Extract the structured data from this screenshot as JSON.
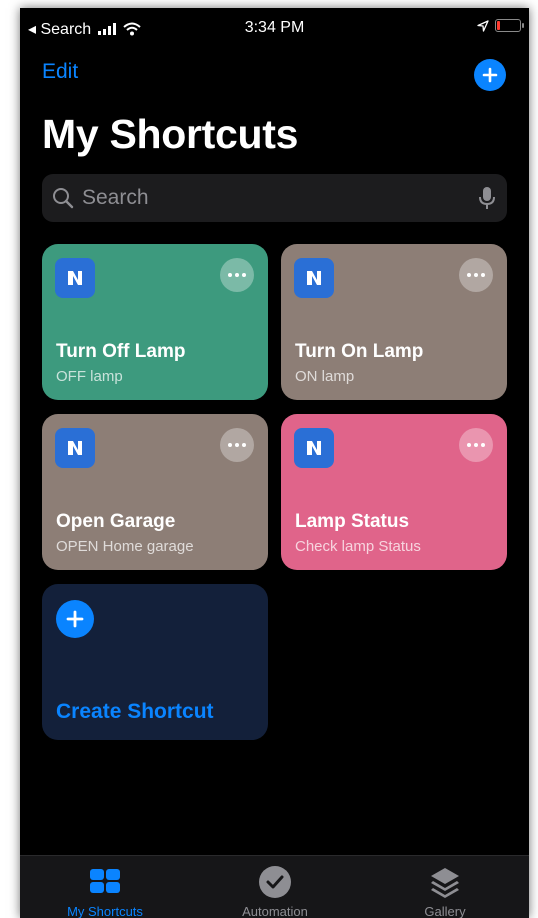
{
  "status_bar": {
    "back_label": "◂ Search",
    "time": "3:34 PM"
  },
  "nav": {
    "edit_label": "Edit",
    "add_icon": "plus-circle-icon"
  },
  "page": {
    "title": "My Shortcuts"
  },
  "search": {
    "placeholder": "Search",
    "value": ""
  },
  "shortcuts": [
    {
      "name": "Turn Off Lamp",
      "subtitle": "OFF lamp",
      "color": "#3d9a7e"
    },
    {
      "name": "Turn On Lamp",
      "subtitle": "ON lamp",
      "color": "#8d7e76"
    },
    {
      "name": "Open Garage",
      "subtitle": "OPEN Home garage",
      "color": "#8d7e76"
    },
    {
      "name": "Lamp Status",
      "subtitle": "Check lamp Status",
      "color": "#e0648a"
    }
  ],
  "create_card": {
    "label": "Create Shortcut"
  },
  "tab_bar": {
    "tabs": [
      {
        "label": "My Shortcuts",
        "icon": "grid-icon",
        "active": true
      },
      {
        "label": "Automation",
        "icon": "checkmark-circle-icon",
        "active": false
      },
      {
        "label": "Gallery",
        "icon": "layers-icon",
        "active": false
      }
    ]
  },
  "colors": {
    "accent": "#0a84ff",
    "background": "#000000",
    "tab_bar": "#161618",
    "app_icon": "#2a6fd6"
  }
}
